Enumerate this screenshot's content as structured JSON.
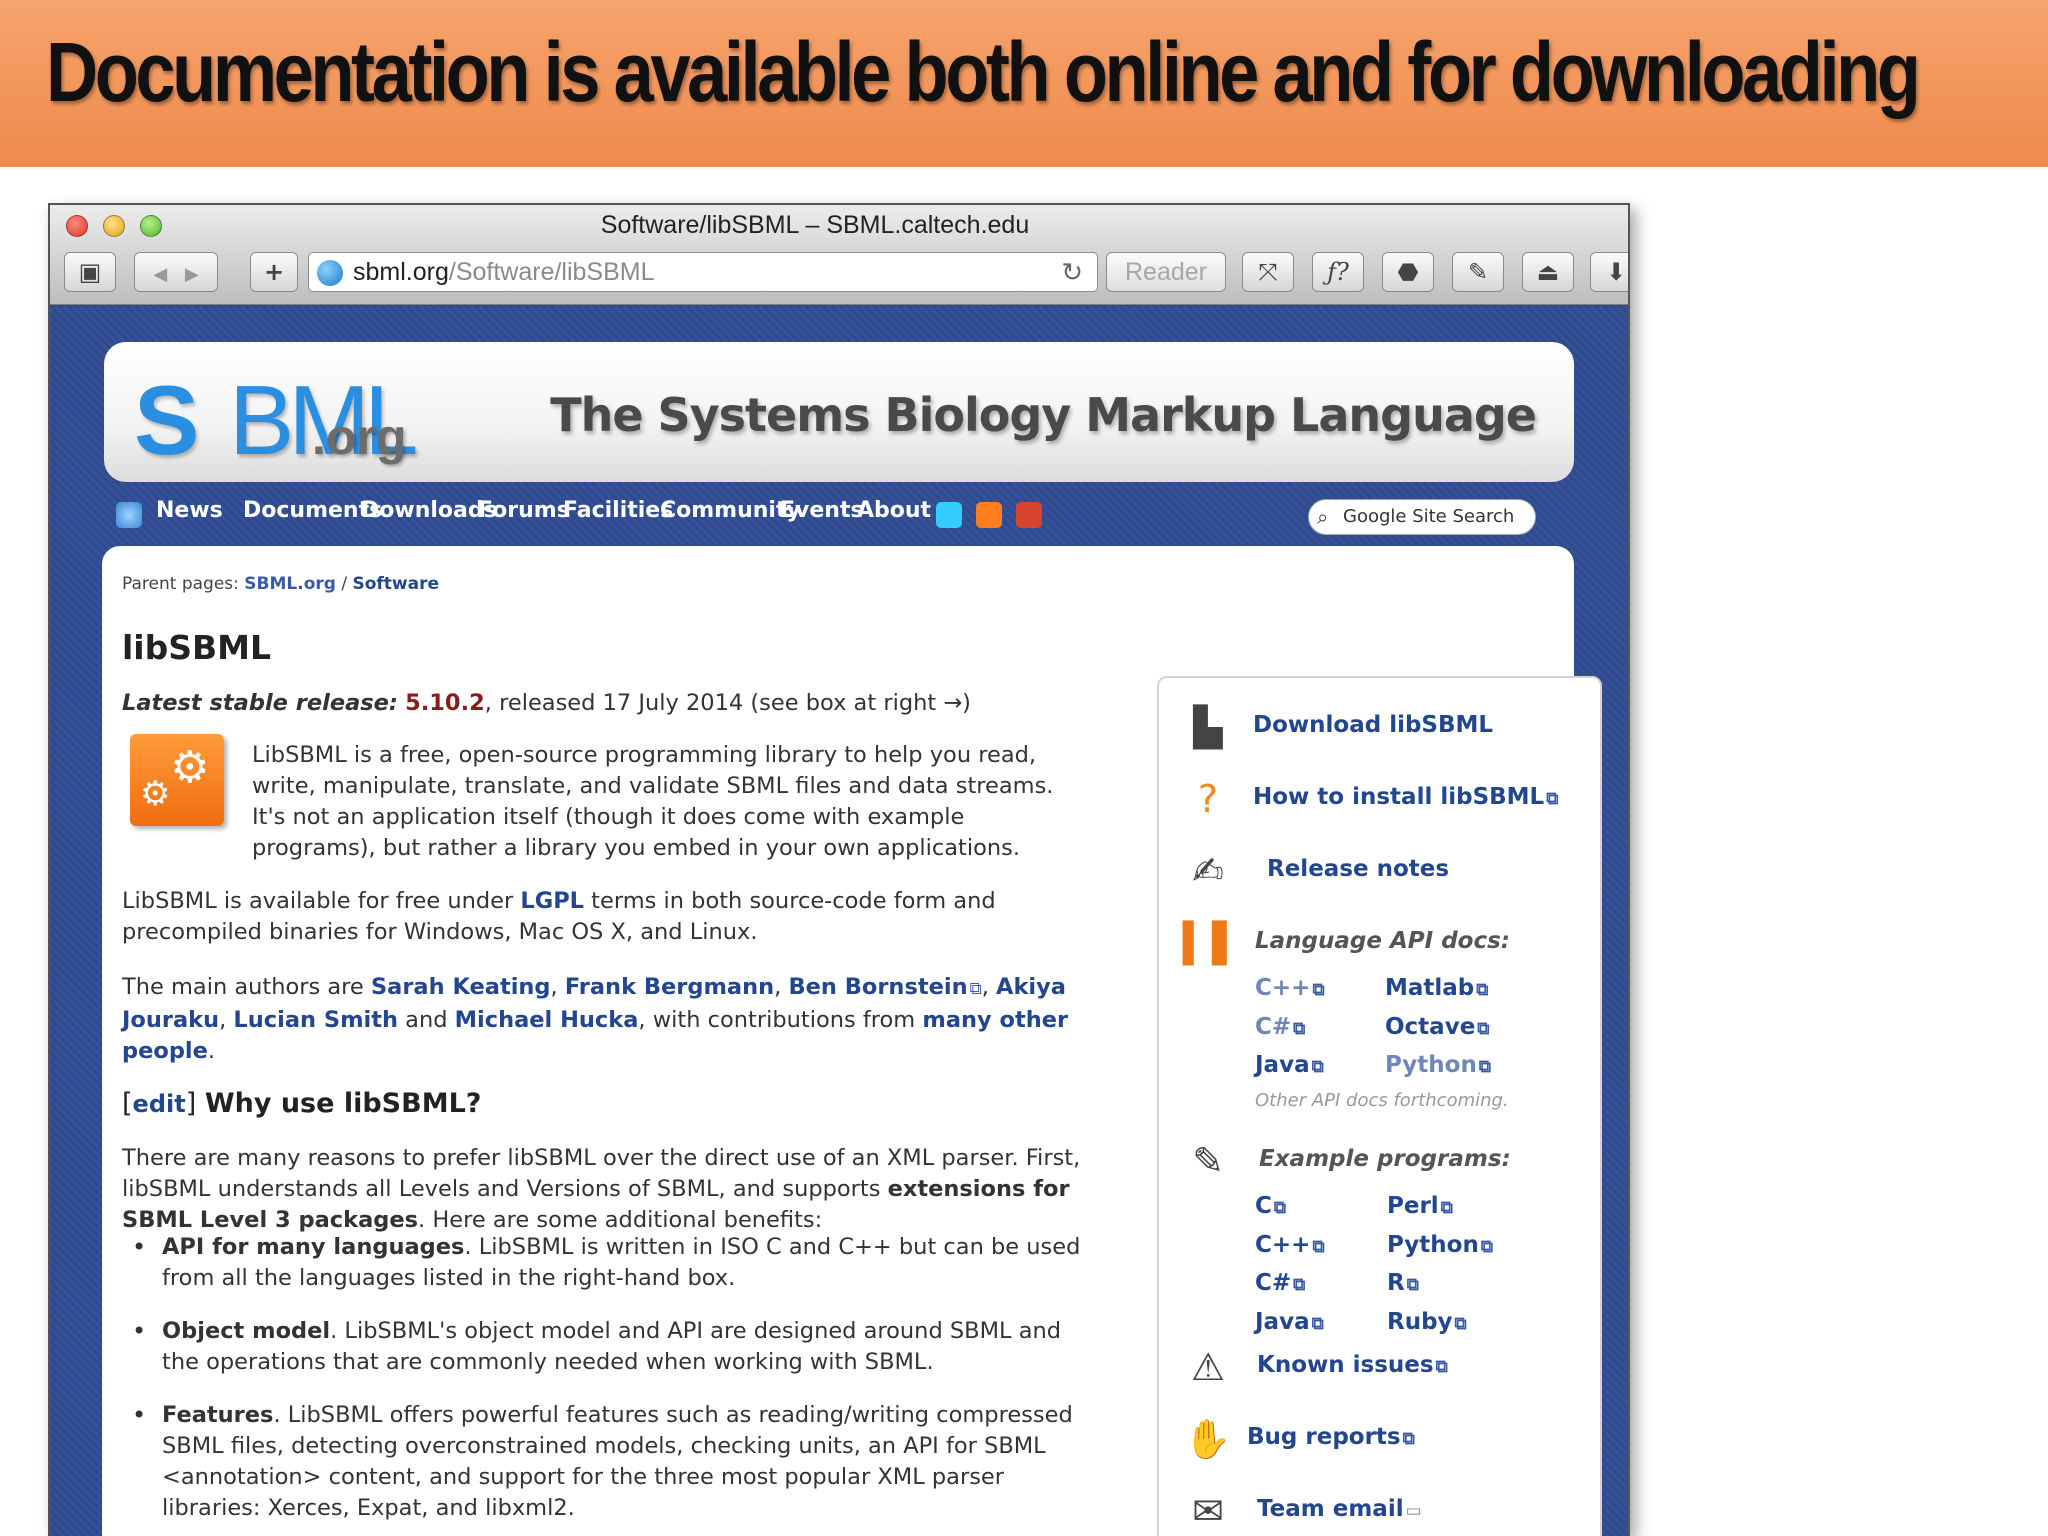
{
  "slide": {
    "title": "Documentation is available both online and for downloading"
  },
  "browser": {
    "window_title": "Software/libSBML – SBML.caltech.edu",
    "url_host": "sbml.org",
    "url_path": "/Software/libSBML",
    "reader_label": "Reader",
    "reload_icon": "↻",
    "back_icon": "◀",
    "forward_icon": "▶",
    "add_icon": "+"
  },
  "site": {
    "logo_s": "S",
    "logo_ml": "BML",
    "logo_org": ".org",
    "tagline": "The Systems Biology Markup Language",
    "nav": [
      "News",
      "Documents",
      "Downloads",
      "Forums",
      "Facilities",
      "Community",
      "Events",
      "About"
    ],
    "search_placeholder": "Google Site Search",
    "colors": {
      "navy": "#22468f",
      "background": "#2f4b8c",
      "accent_orange": "#ef8a4b"
    }
  },
  "page": {
    "parent_label": "Parent pages:",
    "parent_link": "SBML.org",
    "parent_current": "Software",
    "title": "libSBML",
    "release_label": "Latest stable release:",
    "release_version": "5.10.2",
    "release_rest": ", released 17 July 2014 (see box at right →)",
    "intro": "LibSBML is a free, open-source programming library to help you read, write, manipulate, translate, and validate SBML files and data streams. It's not an application itself (though it does come with example programs), but rather a library you embed in your own applications.",
    "license_pre": "LibSBML is available for free under ",
    "license_link": "LGPL",
    "license_post": " terms in both source-code form and precompiled binaries for Windows, Mac OS X, and Linux.",
    "authors_pre": "The main authors are ",
    "author1": "Sarah Keating",
    "author2": "Frank Bergmann",
    "author3": "Ben Bornstein",
    "author4": "Akiya Jouraku",
    "author5": "Lucian Smith",
    "authors_and": " and ",
    "author6": "Michael Hucka",
    "authors_contrib": ", with contributions from ",
    "authors_many": "many other people",
    "edit_label": "edit",
    "why_heading": "Why use libSBML?",
    "why_pre": "There are many reasons to prefer libSBML over the direct use of an XML parser. First, libSBML understands all Levels and Versions of SBML, and supports ",
    "why_bold": "extensions for SBML Level 3 packages",
    "why_post": ". Here are some additional benefits:",
    "bullets": [
      {
        "head": "API for many languages",
        "body": ". LibSBML is written in ISO C and C++ but can be used from all the languages listed in the right-hand box."
      },
      {
        "head": "Object model",
        "body": ". LibSBML's object model and API are designed around SBML and the operations that are commonly needed when working with SBML."
      },
      {
        "head": "Features",
        "body": ". LibSBML offers powerful features such as reading/writing compressed SBML files, detecting overconstrained models, checking units, an API for SBML <annotation> content, and support for the three most popular XML parser libraries: Xerces, Expat, and libxml2."
      }
    ]
  },
  "panel": {
    "download": "Download libSBML",
    "install": "How to install libSBML",
    "release_notes": "Release notes",
    "api_heading": "Language API docs:",
    "api_left": [
      "C++",
      "C#",
      "Java"
    ],
    "api_right": [
      "Matlab",
      "Octave",
      "Python"
    ],
    "api_note": "Other API docs forthcoming.",
    "examples_heading": "Example programs:",
    "examples_left": [
      "C",
      "C++",
      "C#",
      "Java"
    ],
    "examples_right": [
      "Perl",
      "Python",
      "R",
      "Ruby"
    ],
    "known_issues": "Known issues",
    "bug_reports": "Bug reports",
    "team_email": "Team email"
  }
}
